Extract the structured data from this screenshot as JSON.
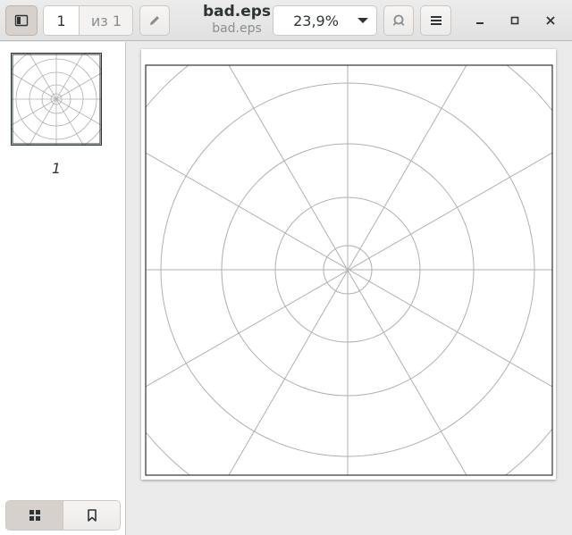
{
  "header": {
    "page_current": "1",
    "page_of": "из 1",
    "title": "bad.eps",
    "subtitle": "bad.eps",
    "zoom": "23,9%"
  },
  "sidebar": {
    "thumbnails": [
      {
        "label": "1"
      }
    ]
  },
  "icons": {
    "sidebar_toggle": "sidebar-icon",
    "annotate": "pencil-icon",
    "zoom_dropdown": "chevron-down-icon",
    "search": "search-icon",
    "menu": "hamburger-menu-icon",
    "minimize": "minimize-icon",
    "maximize": "maximize-icon",
    "close": "close-icon",
    "thumbnails_view": "grid-icon",
    "bookmarks_view": "bookmark-icon"
  },
  "colors": {
    "headerbar": "#e4e4e4",
    "line": "#b0b0b0",
    "frame": "#2e3436"
  }
}
